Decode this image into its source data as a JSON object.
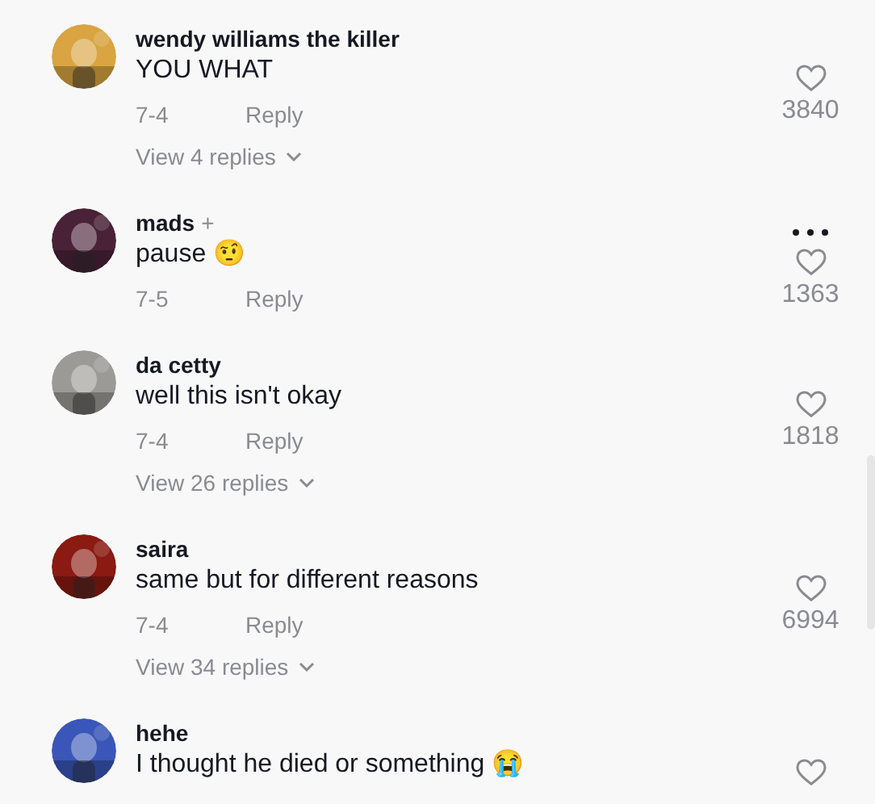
{
  "comments": [
    {
      "user": "wendy williams the killer",
      "text": "YOU WHAT",
      "date": "7-4",
      "reply": "Reply",
      "likes": "3840",
      "replies": "View 4 replies",
      "menu": false
    },
    {
      "user": "mads",
      "badge": "+",
      "text": "pause 🤨",
      "date": "7-5",
      "reply": "Reply",
      "likes": "1363",
      "menu": true
    },
    {
      "user": "da cetty",
      "text": "well this isn't okay",
      "date": "7-4",
      "reply": "Reply",
      "likes": "1818",
      "replies": "View 26 replies",
      "menu": false
    },
    {
      "user": "saira",
      "text": "same but for different reasons",
      "date": "7-4",
      "reply": "Reply",
      "likes": "6994",
      "replies": "View 34 replies",
      "menu": false
    },
    {
      "user": "hehe",
      "text": "I thought he died or something 😭",
      "menu": false
    }
  ]
}
